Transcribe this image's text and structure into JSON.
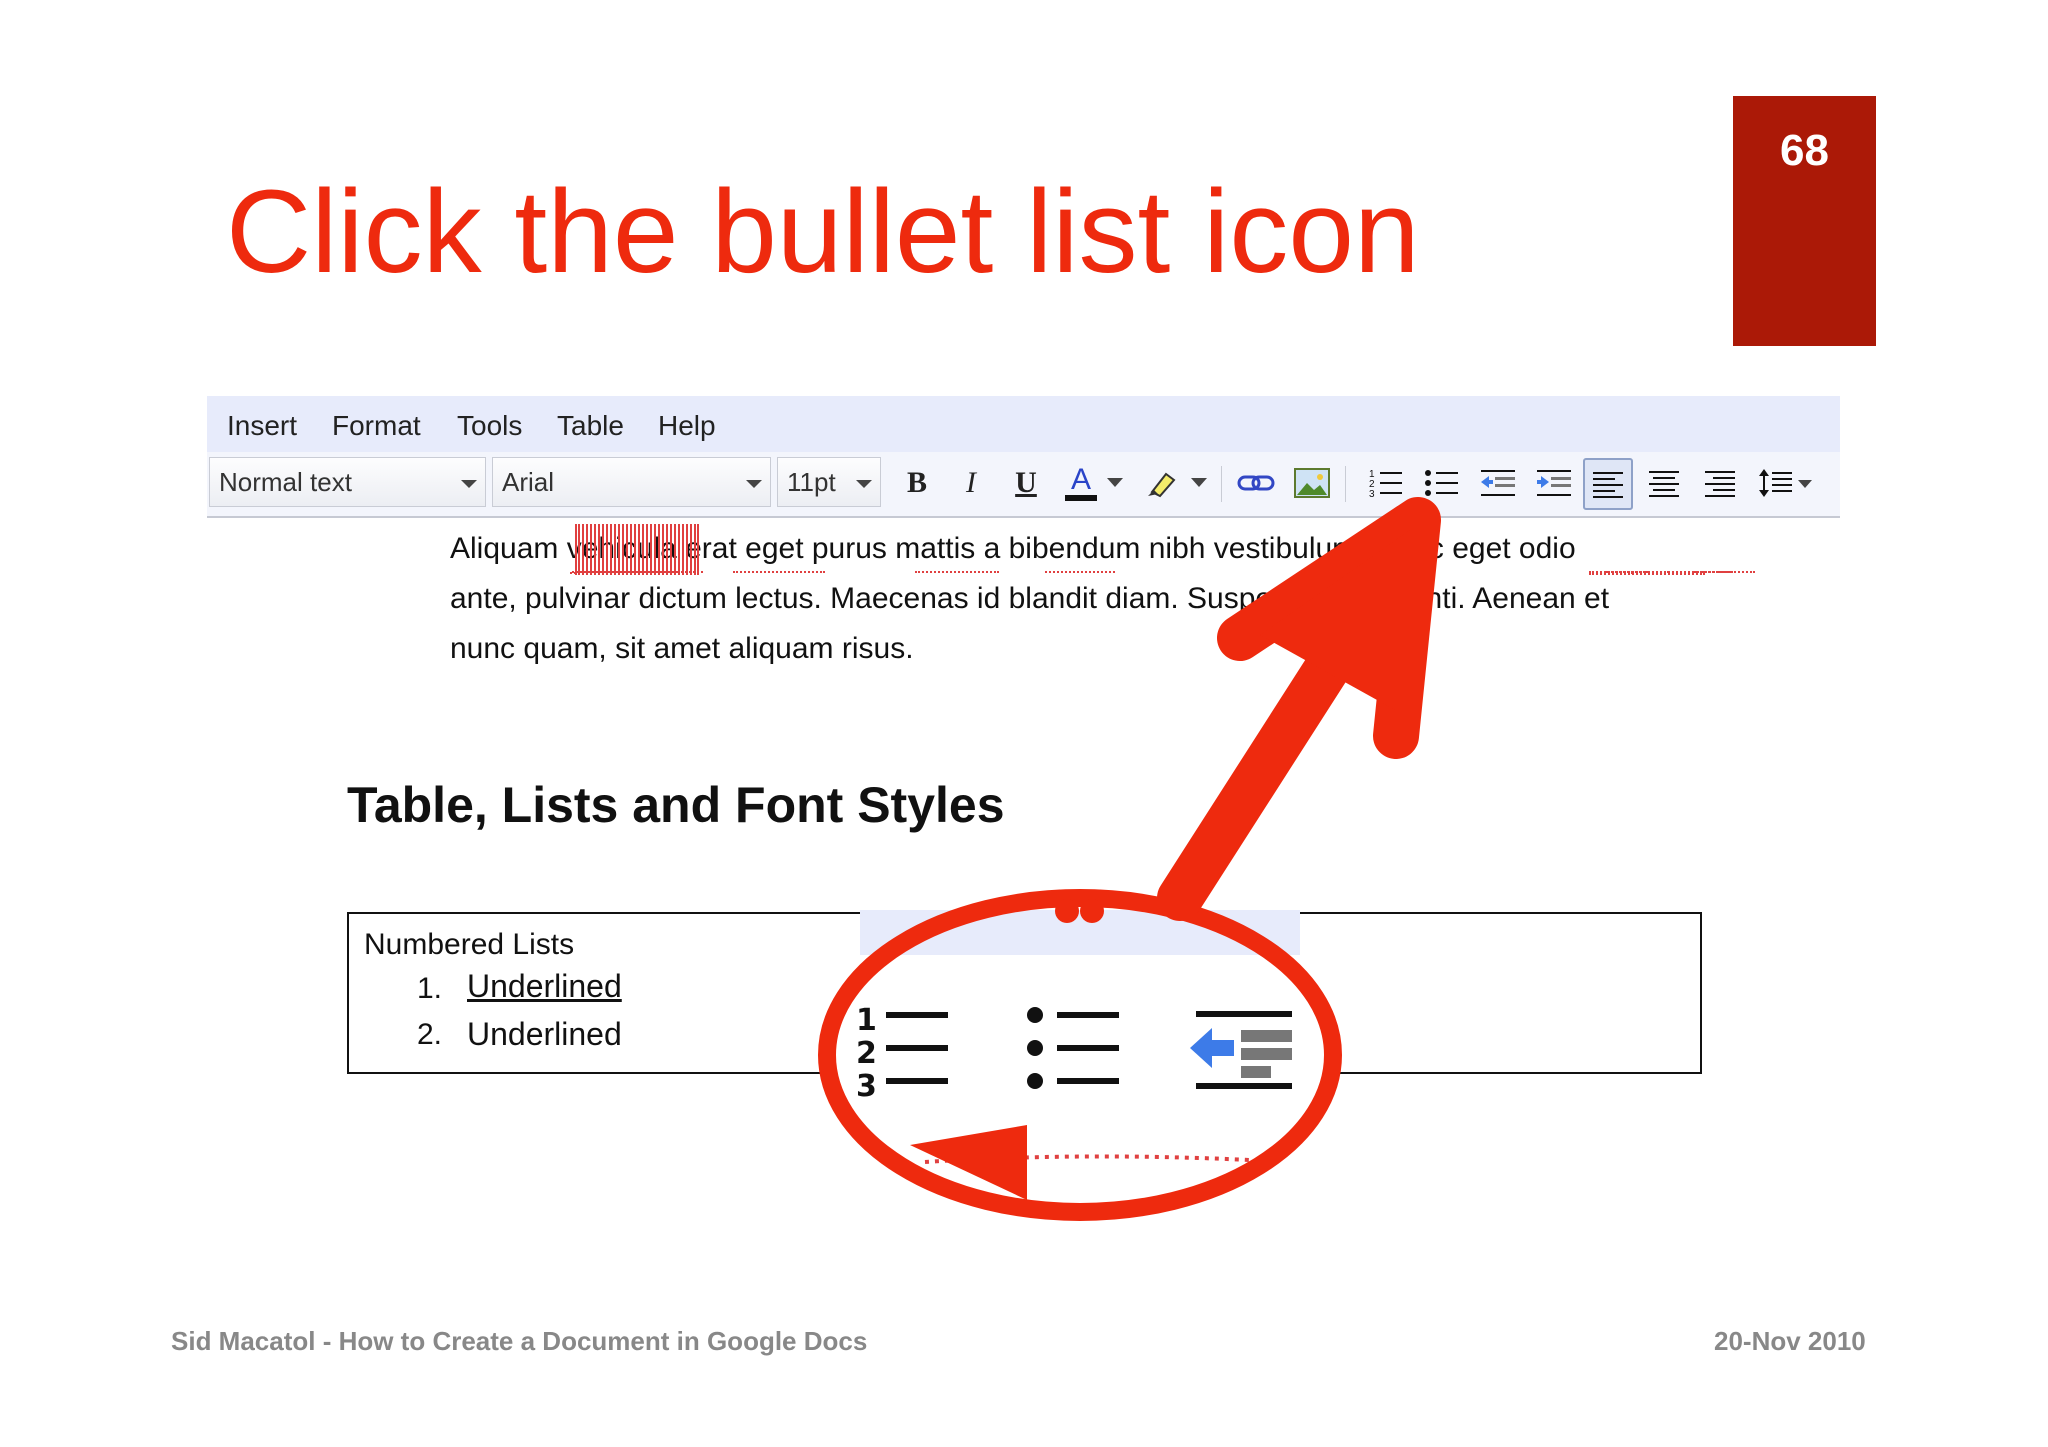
{
  "slide": {
    "title": "Click the bullet list icon",
    "page_number": "68",
    "footer_left": "Sid Macatol - How to Create a Document in Google Docs",
    "footer_right": "20-Nov 2010"
  },
  "menu": {
    "items": [
      "Insert",
      "Format",
      "Tools",
      "Table",
      "Help"
    ]
  },
  "toolbar": {
    "style_select": "Normal text",
    "font_select": "Arial",
    "size_select": "11pt",
    "bold_label": "B",
    "italic_label": "I",
    "underline_label": "U",
    "text_color_label": "A",
    "icons": [
      "bold-icon",
      "italic-icon",
      "underline-icon",
      "text-color-icon",
      "highlight-icon",
      "link-icon",
      "image-icon",
      "numbered-list-icon",
      "bullet-list-icon",
      "decrease-indent-icon",
      "increase-indent-icon",
      "align-left-icon",
      "align-center-icon",
      "align-right-icon",
      "line-spacing-icon"
    ]
  },
  "document": {
    "paragraph": [
      "Aliquam vehicula erat eget purus mattis a bibendum nibh vestibulum. Nunc eget odio",
      "ante, pulvinar dictum lectus. Maecenas id blandit diam. Suspendisse potenti. Aenean et",
      "nunc quam, sit amet aliquam risus."
    ],
    "heading": "Table, Lists and Font Styles",
    "table": {
      "heading": "Numbered Lists",
      "items": [
        {
          "number": "1.",
          "text": "Underlined"
        },
        {
          "number": "2.",
          "text": "Underlined"
        }
      ]
    }
  },
  "annotation": {
    "color": "#ee2a0e",
    "callout_icons": [
      "numbered-list-icon",
      "bullet-list-icon",
      "decrease-indent-icon"
    ]
  }
}
